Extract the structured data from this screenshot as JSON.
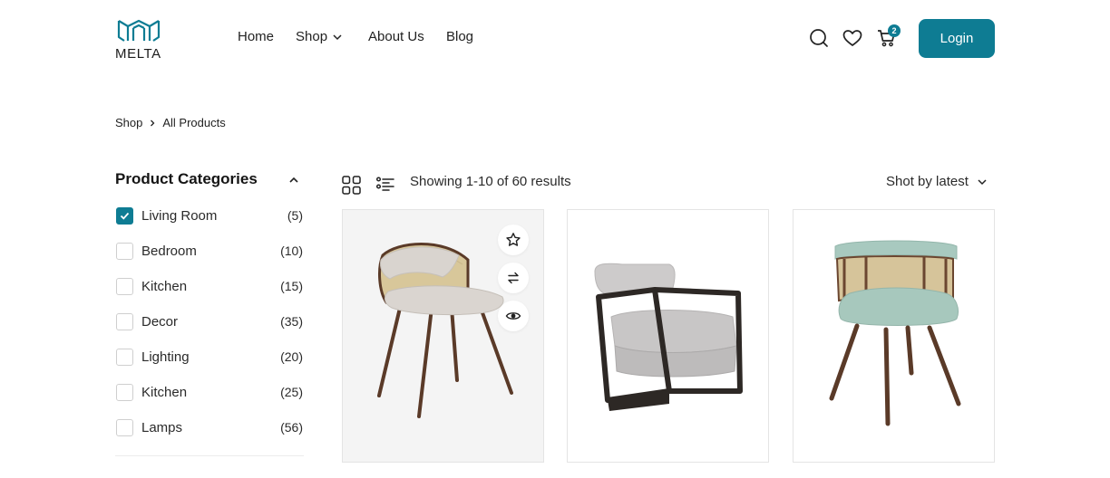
{
  "brand": {
    "name": "MELTA",
    "accent_color": "#0e7c93"
  },
  "nav": {
    "home": "Home",
    "shop": "Shop",
    "about": "About Us",
    "blog": "Blog"
  },
  "header_icons": [
    "search-icon",
    "heart-icon",
    "cart-icon"
  ],
  "cart": {
    "count": "2"
  },
  "login_label": "Login",
  "breadcrumb": {
    "parent": "Shop",
    "current": "All Products"
  },
  "sidebar": {
    "title": "Product Categories",
    "categories": [
      {
        "label": "Living Room",
        "count": "(5)",
        "checked": true
      },
      {
        "label": "Bedroom",
        "count": "(10)",
        "checked": false
      },
      {
        "label": "Kitchen",
        "count": "(15)",
        "checked": false
      },
      {
        "label": "Decor",
        "count": "(35)",
        "checked": false
      },
      {
        "label": "Lighting",
        "count": "(20)",
        "checked": false
      },
      {
        "label": "Kitchen",
        "count": "(25)",
        "checked": false
      },
      {
        "label": "Lamps",
        "count": "(56)",
        "checked": false
      }
    ]
  },
  "toolbar": {
    "results_text": "Showing 1-10 of 60 results",
    "sort_label": "Shot by latest"
  },
  "products": [
    {
      "image": "cane-back-dining-chair",
      "actions": [
        "star-icon",
        "compare-icon",
        "eye-icon"
      ]
    },
    {
      "image": "grey-lounge-armchair"
    },
    {
      "image": "mint-barrel-chair"
    }
  ]
}
